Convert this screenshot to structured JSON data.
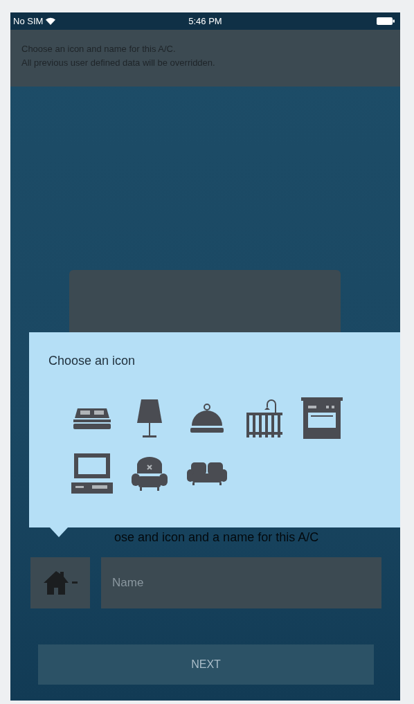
{
  "status_bar": {
    "carrier": "No SIM",
    "time": "5:46 PM"
  },
  "banner": {
    "lines": [
      "Choose an icon and name for this A/C.",
      "All previous user defined data will be overridden."
    ]
  },
  "popover": {
    "title": "Choose an icon",
    "icons": [
      {
        "kind": "bed"
      },
      {
        "kind": "lamp"
      },
      {
        "kind": "cloche"
      },
      {
        "kind": "crib"
      },
      {
        "kind": "oven"
      },
      {
        "kind": "computer"
      },
      {
        "kind": "armchair"
      },
      {
        "kind": "sofa"
      }
    ]
  },
  "prompt": "ose and icon and a name for this A/C",
  "name_field": {
    "placeholder": "Name"
  },
  "next_button": "NEXT"
}
